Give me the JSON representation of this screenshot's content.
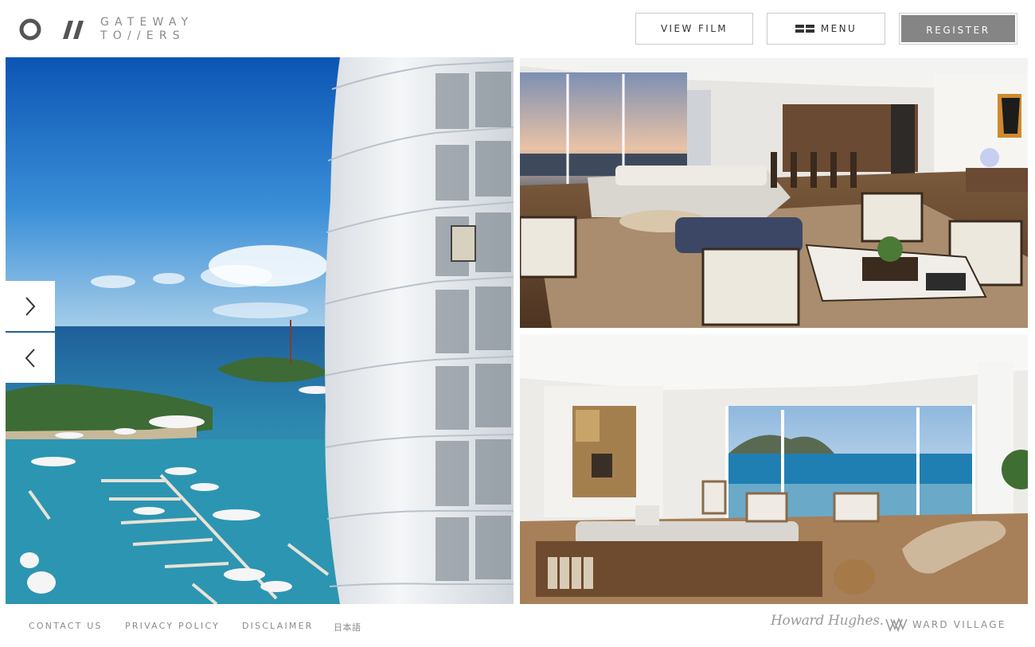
{
  "header": {
    "logo_line1": "GATEWAY",
    "logo_line2": "TO//ERS",
    "view_film_label": "VIEW FILM",
    "menu_label": "MENU",
    "register_label": "REGISTER"
  },
  "slider": {
    "next_icon": "chevron-right-icon",
    "prev_icon": "chevron-left-icon"
  },
  "footer": {
    "links": [
      "CONTACT US",
      "PRIVACY POLICY",
      "DISCLAIMER",
      "日本語"
    ],
    "partner_logo_1": "Howard Hughes.",
    "partner_logo_2": "WARD VILLAGE"
  },
  "colors": {
    "register_bg": "#858585",
    "text_muted": "#8b8b8b",
    "sky": "#1f6fc0",
    "ocean": "#2f8fb3"
  }
}
